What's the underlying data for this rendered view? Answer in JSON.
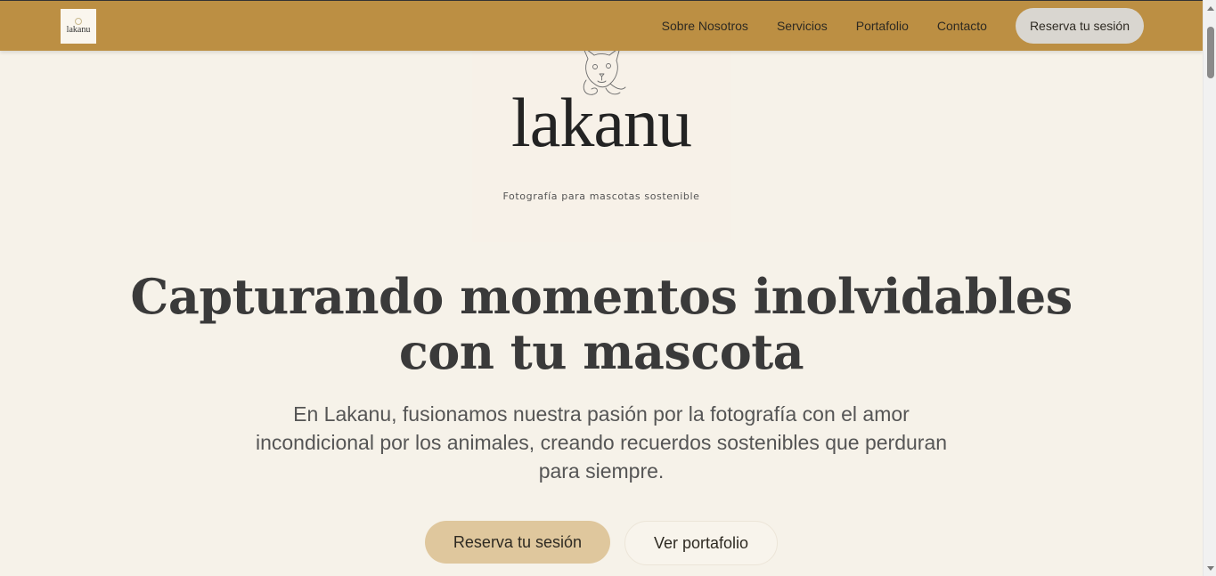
{
  "header": {
    "logo_text": "lakanu",
    "nav": [
      {
        "label": "Sobre Nosotros"
      },
      {
        "label": "Servicios"
      },
      {
        "label": "Portafolio"
      },
      {
        "label": "Contacto"
      }
    ],
    "cta_label": "Reserva tu sesión"
  },
  "brand": {
    "wordmark": "lakanu",
    "tagline": "Fotografía para mascotas sostenible"
  },
  "hero": {
    "title_line1": "Capturando momentos inolvidables",
    "title_line2": "con tu mascota",
    "subtitle": "En Lakanu, fusionamos nuestra pasión por la fotografía con el amor incondicional por los animales, creando recuerdos sostenibles que perduran para siempre.",
    "primary_button": "Reserva tu sesión",
    "secondary_button": "Ver portafolio"
  },
  "colors": {
    "header_bg": "#bc8f43",
    "page_bg": "#f6f2e9",
    "primary_button_bg": "#dfc79d",
    "nav_cta_bg": "#d9d6d0"
  }
}
